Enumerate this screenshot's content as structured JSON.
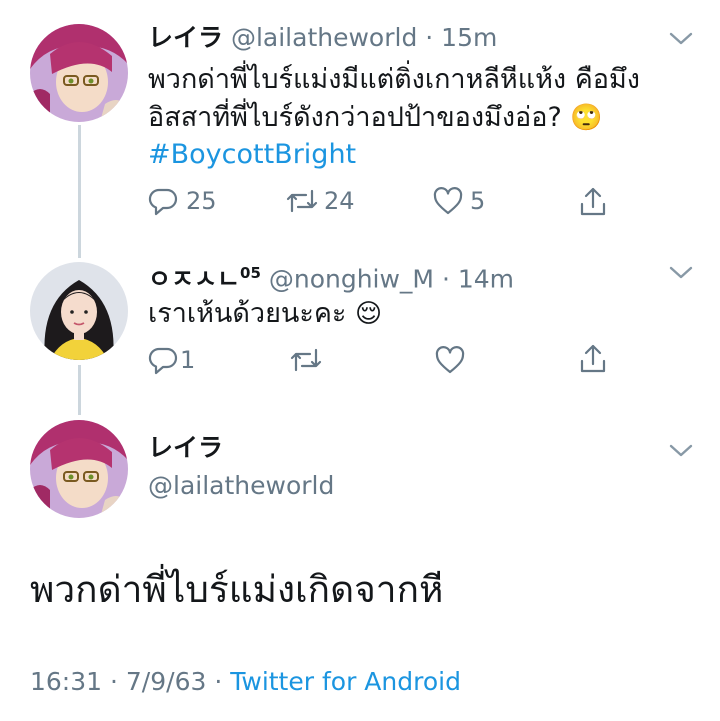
{
  "tweet1": {
    "display_name": "レイラ",
    "handle": "@lailatheworld",
    "time": "15m",
    "text_line1": "พวกด่าพี่ไบร์แม่งมีแต่ติ่งเกาหลีหีแห้ง คือมึง",
    "text_line2": "อิสสาที่พี่ไบร์ดังกว่าอปป้าของมึงอ่อ?",
    "emoji": "🙄",
    "hashtag": "#BoycottBright",
    "replies": "25",
    "retweets": "24",
    "likes": "5"
  },
  "tweet2": {
    "display_name": "ㅇㅈㅅㄴ",
    "display_name_sup": "05",
    "handle": "@nonghiw_M",
    "time": "14m",
    "text": "เราเห้นด้วยนะคะ",
    "emoji": "😌",
    "replies": "1"
  },
  "tweet3": {
    "display_name": "レイラ",
    "handle": "@lailatheworld",
    "text": "พวกด่าพี่ไบร์แม่งเกิดจากหี",
    "time": "16:31",
    "date": "7/9/63",
    "source": "Twitter for Android"
  },
  "separator": "·",
  "colors": {
    "text": "#14171a",
    "muted": "#657786",
    "link": "#1b95e0",
    "thread_line": "#ccd6dd"
  },
  "icons": [
    "chevron-down-icon",
    "reply-icon",
    "retweet-icon",
    "like-icon",
    "share-icon"
  ]
}
